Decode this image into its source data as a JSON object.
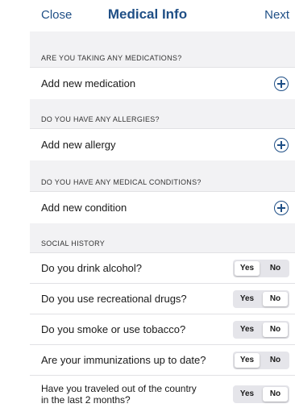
{
  "navbar": {
    "close_label": "Close",
    "title": "Medical Info",
    "next_label": "Next"
  },
  "sections": {
    "medications": {
      "header": "ARE YOU TAKING ANY MEDICATIONS?",
      "add_label": "Add new medication"
    },
    "allergies": {
      "header": "DO YOU HAVE ANY ALLERGIES?",
      "add_label": "Add new allergy"
    },
    "conditions": {
      "header": "DO YOU HAVE ANY MEDICAL CONDITIONS?",
      "add_label": "Add new condition"
    },
    "social": {
      "header": "SOCIAL HISTORY",
      "questions": [
        {
          "label": "Do you drink alcohol?",
          "selected": "Yes"
        },
        {
          "label": "Do you use recreational drugs?",
          "selected": "No"
        },
        {
          "label": "Do you smoke or use tobacco?",
          "selected": "No"
        },
        {
          "label": "Are your immunizations up to date?",
          "selected": "Yes"
        },
        {
          "label": "Have you traveled out of the country in the last 2 months?",
          "selected": "No"
        }
      ]
    }
  },
  "toggle": {
    "yes_label": "Yes",
    "no_label": "No"
  },
  "colors": {
    "accent": "#1f4f86",
    "section_background": "#f2f2f4",
    "toggle_track": "#e5e5ea"
  },
  "icons": {
    "add": "plus-circle-icon"
  }
}
